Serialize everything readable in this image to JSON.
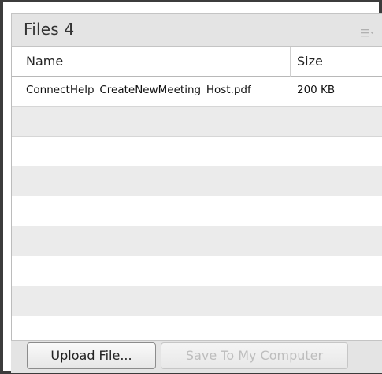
{
  "panel": {
    "title": "Files 4",
    "menu_icon": "menu-dropdown-icon"
  },
  "table": {
    "columns": [
      "Name",
      "Size"
    ],
    "rows": [
      {
        "name": "ConnectHelp_CreateNewMeeting_Host.pdf",
        "size": "200 KB"
      }
    ]
  },
  "footer": {
    "upload_label": "Upload File...",
    "save_label": "Save To My Computer"
  }
}
